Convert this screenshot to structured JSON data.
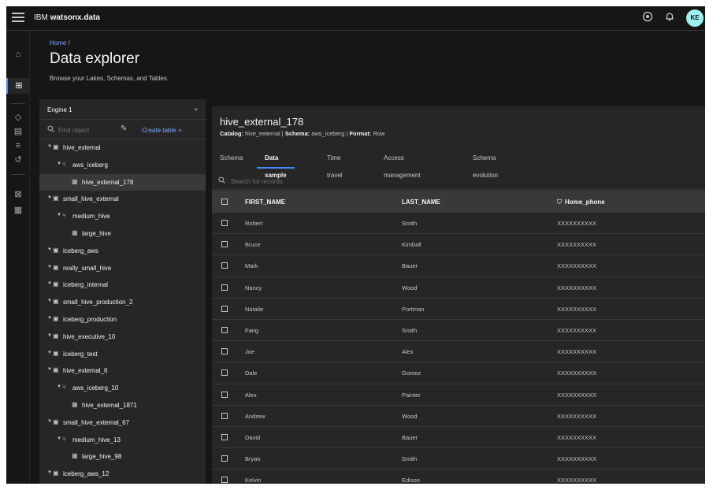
{
  "header": {
    "brand_prefix": "IBM",
    "brand_name": "watsonx.data",
    "icons": [
      "menu-icon",
      "help-icon",
      "notification-icon"
    ],
    "avatar_initials": "KE"
  },
  "breadcrumb": {
    "home": "Home",
    "separator": "/"
  },
  "page": {
    "title": "Data explorer",
    "subtitle": "Browse your Lakes, Schemas, and Tables."
  },
  "tree": {
    "engine": "Engine 1",
    "search_placeholder": "Find object",
    "create_label": "Create table",
    "create_icon": "+",
    "items": [
      {
        "label": "hive_external",
        "level": 0,
        "kind": "catalog",
        "expanded": true
      },
      {
        "label": "aws_iceberg",
        "level": 1,
        "kind": "schema",
        "expanded": true
      },
      {
        "label": "hive_external_178",
        "level": 2,
        "kind": "table",
        "selected": true
      },
      {
        "label": "small_hive_external",
        "level": 0,
        "kind": "catalog",
        "expanded": true
      },
      {
        "label": "medium_hive",
        "level": 1,
        "kind": "schema",
        "expanded": true
      },
      {
        "label": "large_hive",
        "level": 2,
        "kind": "table"
      },
      {
        "label": "iceberg_aws",
        "level": 0,
        "kind": "catalog"
      },
      {
        "label": "really_small_hive",
        "level": 0,
        "kind": "catalog"
      },
      {
        "label": "iceberg_internal",
        "level": 0,
        "kind": "catalog"
      },
      {
        "label": "small_hive_production_2",
        "level": 0,
        "kind": "catalog"
      },
      {
        "label": "iceberg_production",
        "level": 0,
        "kind": "catalog"
      },
      {
        "label": "hive_executive_10",
        "level": 0,
        "kind": "catalog"
      },
      {
        "label": "iceberg_test",
        "level": 0,
        "kind": "catalog"
      },
      {
        "label": "hive_external_6",
        "level": 0,
        "kind": "catalog",
        "expanded": true
      },
      {
        "label": "aws_iceberg_10",
        "level": 1,
        "kind": "schema",
        "expanded": true
      },
      {
        "label": "hive_external_1871",
        "level": 2,
        "kind": "table"
      },
      {
        "label": "small_hive_external_67",
        "level": 0,
        "kind": "catalog",
        "expanded": true
      },
      {
        "label": "medium_hive_13",
        "level": 1,
        "kind": "schema",
        "expanded": true
      },
      {
        "label": "large_hive_98",
        "level": 2,
        "kind": "table"
      },
      {
        "label": "iceberg_aws_12",
        "level": 0,
        "kind": "catalog"
      }
    ]
  },
  "table": {
    "name": "hive_external_178",
    "catalog_label": "Catalog:",
    "catalog": "hive_external",
    "schema_label": "Schema:",
    "schema": "aws_iceberg",
    "format_label": "Format:",
    "format": "Row",
    "tabs": [
      "Schema",
      "Data sample",
      "Time travel",
      "Access management",
      "Schema evolution"
    ],
    "active_tab": "Data sample",
    "records_search_placeholder": "Search for records",
    "columns": [
      "FIRST_NAME",
      "LAST_NAME",
      "Home_phone"
    ],
    "rows": [
      [
        "Robert",
        "Smith",
        "XXXXXXXXXX"
      ],
      [
        "Bruce",
        "Kimball",
        "XXXXXXXXXX"
      ],
      [
        "Mark",
        "Bauer",
        "XXXXXXXXXX"
      ],
      [
        "Nancy",
        "Wood",
        "XXXXXXXXXX"
      ],
      [
        "Natalie",
        "Portman",
        "XXXXXXXXXX"
      ],
      [
        "Fang",
        "Smith",
        "XXXXXXXXXX"
      ],
      [
        "Joe",
        "Alex",
        "XXXXXXXXXX"
      ],
      [
        "Dale",
        "Gomez",
        "XXXXXXXXXX"
      ],
      [
        "Alex",
        "Painter",
        "XXXXXXXXXX"
      ],
      [
        "Andrew",
        "Wood",
        "XXXXXXXXXX"
      ],
      [
        "David",
        "Bauer",
        "XXXXXXXXXX"
      ],
      [
        "Bryan",
        "Smith",
        "XXXXXXXXXX"
      ],
      [
        "Kelvin",
        "Edison",
        "XXXXXXXXXX"
      ]
    ]
  },
  "colors": {
    "background": "#161616",
    "panel": "#262626",
    "accent": "#4589ff",
    "link": "#78a9ff",
    "avatar": "#9ef0f0"
  }
}
